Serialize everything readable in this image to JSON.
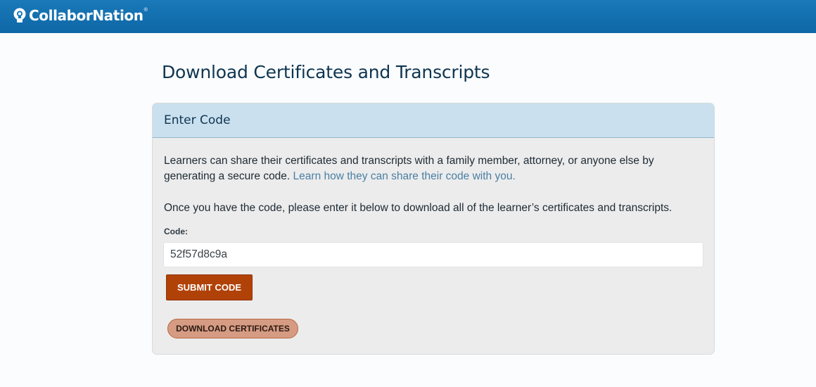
{
  "header": {
    "brand_name": "CollaborNation",
    "brand_mark": "®",
    "logo_icon": "lightbulb-head-icon",
    "background_color": "#1a79b8"
  },
  "page": {
    "title": "Download Certificates and Transcripts"
  },
  "card": {
    "header_title": "Enter Code",
    "description_text": "Learners can share their certificates and transcripts with a family member, attorney, or anyone else by generating a secure code. ",
    "description_link": "Learn how they can share their code with you.",
    "instruction_text": "Once you have the code, please enter it below to download all of the learner’s certificates and transcripts.",
    "code_label": "Code:",
    "code_value": "52f57d8c9a",
    "submit_label": "SUBMIT CODE",
    "download_label": "DOWNLOAD CERTIFICATES"
  },
  "colors": {
    "accent": "#b14207",
    "download_button": "#d69b83",
    "card_header": "#cae0ee",
    "link": "#4a7fa2"
  }
}
